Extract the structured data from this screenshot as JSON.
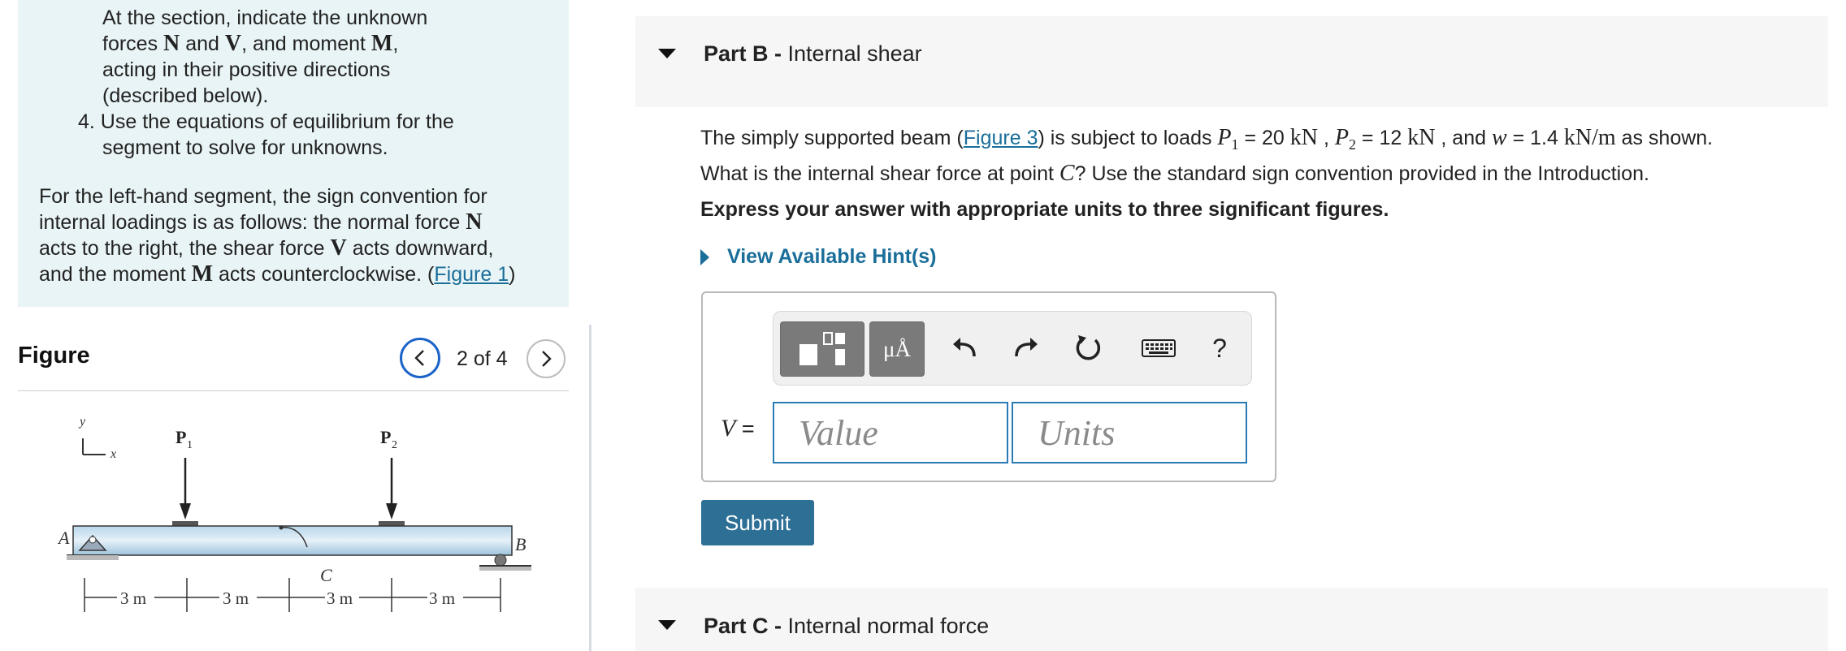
{
  "intro": {
    "step3_line1": "At the section, indicate the unknown",
    "step3_line2a": "forces ",
    "var_N": "N",
    "word_and": " and ",
    "var_V": "V",
    "step3_line2b": ", and moment ",
    "var_M": "M",
    "step3_line2c": ",",
    "step3_line3": "acting in their positive directions",
    "step3_line4": "(described below).",
    "step4_line1": "4. Use the equations of equilibrium for the",
    "step4_line2": "segment to solve for unknowns.",
    "conv_line1": "For the left-hand segment, the sign convention for",
    "conv_line2a": "internal loadings is as follows: the normal force ",
    "conv_line3a": "acts to the right, the shear force ",
    "conv_line3b": " acts downward,",
    "conv_line4a": "and the moment ",
    "conv_line4b": " acts counterclockwise. (",
    "conv_link": "Figure 1",
    "conv_line4c": ")"
  },
  "figure": {
    "title": "Figure",
    "counter": "2 of 4",
    "labels": {
      "y": "y",
      "x": "x",
      "P1": "P",
      "P1_sub": "1",
      "P2": "P",
      "P2_sub": "2",
      "A": "A",
      "B": "B",
      "C": "C",
      "dim1": "3 m",
      "dim2": "3 m",
      "dim3": "3 m",
      "dim4": "3 m"
    }
  },
  "partB": {
    "prefix": "Part B - ",
    "title": "Internal shear",
    "q1": "The simply supported beam (",
    "q_link": "Figure 3",
    "q2": ") is subject to loads ",
    "p1_var": "P",
    "p1_sub": "1",
    "p1_val": " = 20 ",
    "unit_kN": "kN",
    "sep1": " , ",
    "p2_var": "P",
    "p2_sub": "2",
    "p2_val": " = 12 ",
    "sep2": " , and ",
    "w_var": "w",
    "w_val": " = 1.4 ",
    "unit_kNm": "kN/m",
    "q3": " as shown.",
    "q4": "What is the internal shear force at point ",
    "c_var": "C",
    "q5": "? Use the standard sign convention provided in the Introduction.",
    "instruction": "Express your answer with appropriate units to three significant figures.",
    "hint": "View Available Hint(s)",
    "var_label": "V",
    "equals": " =",
    "value_placeholder": "Value",
    "units_placeholder": "Units",
    "units_tool": "μÅ",
    "help_tool": "?",
    "submit": "Submit"
  },
  "partC": {
    "prefix": "Part C - ",
    "title": "Internal normal force"
  }
}
